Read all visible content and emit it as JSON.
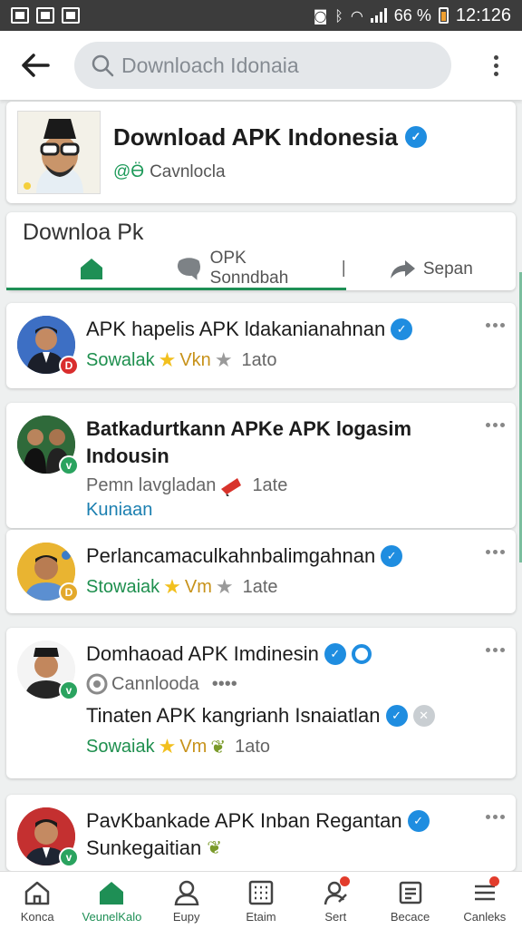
{
  "status_bar": {
    "battery": "66 %",
    "time": "12:126"
  },
  "search": {
    "placeholder": "Downloach Idonaia"
  },
  "profile": {
    "name": "Download APK Indonesia",
    "handle_prefix": "@Ӫ",
    "handle": "Cavnlocla"
  },
  "tabs": {
    "title": "Downloa Pk",
    "items": [
      {
        "label": "",
        "icon": "home-icon"
      },
      {
        "label": "OPK Sonndbah",
        "icon": "chat-icon"
      },
      {
        "label": "Sepan",
        "icon": "share-icon"
      }
    ],
    "separator": "|"
  },
  "posts": [
    {
      "title": "APK hapelis APK ldakanianahnan",
      "author": "Sowalak",
      "tag": "Vkn",
      "time": "1ato",
      "badge": "D",
      "badge_color": "#d92d2d"
    },
    {
      "title": "Batkadurtkann APKe APK logasim Indousin",
      "line2": "Pemn lavgladan",
      "time": "1ate",
      "link": "Kuniaan",
      "badge": "v",
      "badge_color": "#2aa35f"
    },
    {
      "title": "Perlancamaculkahnbalimgahnan",
      "author": "Stowaiak",
      "tag": "Vm",
      "time": "1ate",
      "badge": "D",
      "badge_color": "#e3a92b"
    },
    {
      "title": "Domhaoad APK Imdinesin",
      "sub": "Cannlooda",
      "sub_dots": "••••",
      "line": "Tinaten APK kangrianh Isnaiatlan",
      "author": "Sowaiak",
      "tag": "Vm",
      "time": "1ato",
      "badge": "v",
      "badge_color": "#2aa35f"
    },
    {
      "title": "PavKbankade APK Inban Regantan",
      "line": "Sunkegaitian",
      "badge": "v",
      "badge_color": "#2aa35f"
    }
  ],
  "bottom_nav": [
    {
      "label": "Konca",
      "icon": "home-outline-icon"
    },
    {
      "label": "VeunelKalo",
      "icon": "home-filled-icon"
    },
    {
      "label": "Eupy",
      "icon": "profile-icon"
    },
    {
      "label": "Etaim",
      "icon": "grid-icon"
    },
    {
      "label": "Sert",
      "icon": "person-alert-icon"
    },
    {
      "label": "Becace",
      "icon": "document-icon"
    },
    {
      "label": "Canleks",
      "icon": "menu-icon"
    }
  ],
  "colors": {
    "accent": "#1e8f55",
    "verified": "#1f8de0"
  }
}
